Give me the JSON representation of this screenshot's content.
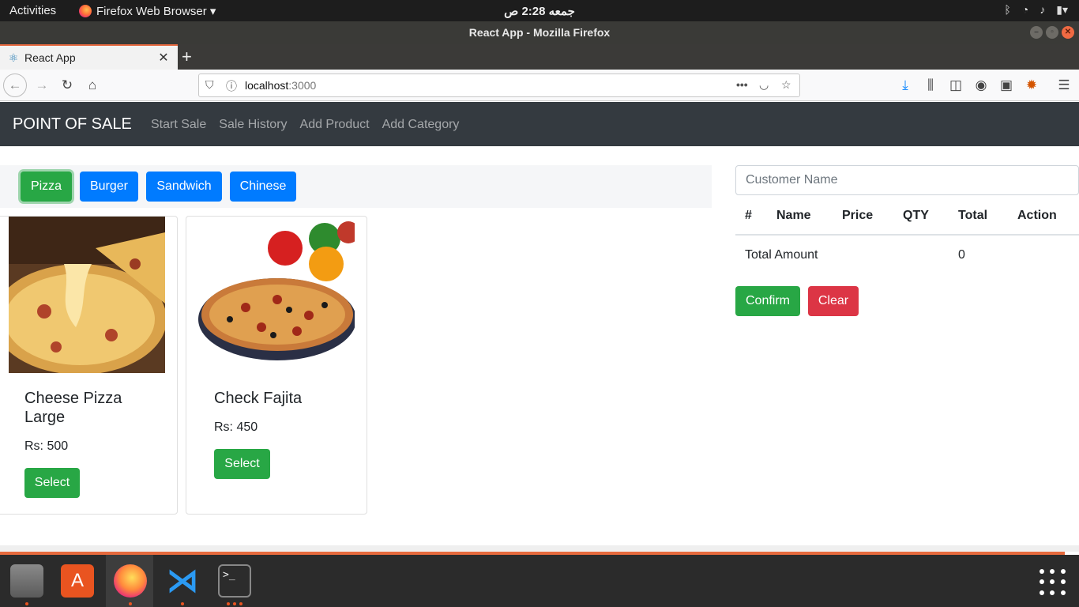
{
  "system": {
    "activities": "Activities",
    "app_menu": "Firefox Web Browser ▾",
    "clock": "جمعه  2:28 ص"
  },
  "window": {
    "title": "React App - Mozilla Firefox"
  },
  "browser": {
    "tab_title": "React App",
    "url_host": "localhost",
    "url_port": ":3000"
  },
  "app": {
    "brand": "POINT OF SALE",
    "nav": [
      "Start Sale",
      "Sale History",
      "Add Product",
      "Add Category"
    ],
    "categories": [
      {
        "label": "Pizza",
        "active": true
      },
      {
        "label": "Burger",
        "active": false
      },
      {
        "label": "Sandwich",
        "active": false
      },
      {
        "label": "Chinese",
        "active": false
      }
    ],
    "products": [
      {
        "name": "Cheese Pizza Large",
        "price": "Rs: 500",
        "select_label": "Select"
      },
      {
        "name": "Check Fajita",
        "price": "Rs: 450",
        "select_label": "Select"
      }
    ],
    "cart": {
      "customer_placeholder": "Customer Name",
      "headers": [
        "#",
        "Name",
        "Price",
        "QTY",
        "Total",
        "Action"
      ],
      "total_label": "Total Amount",
      "total_value": "0",
      "confirm_label": "Confirm",
      "clear_label": "Clear"
    }
  }
}
